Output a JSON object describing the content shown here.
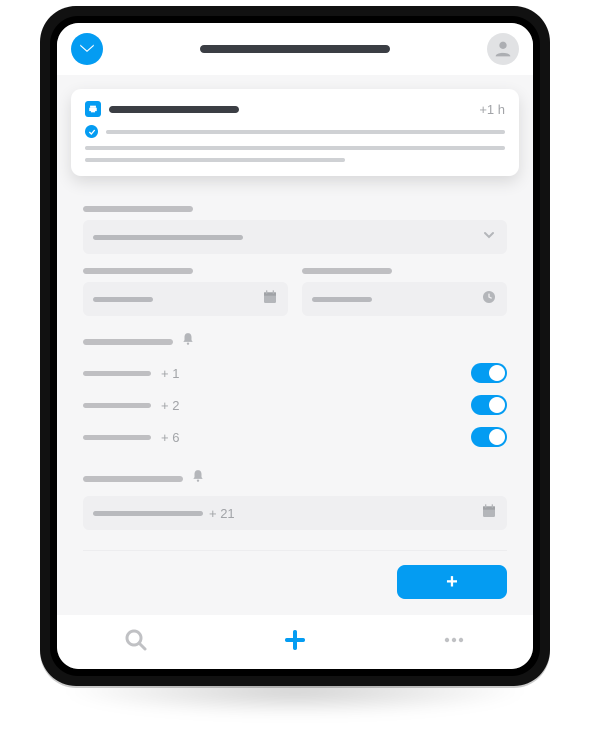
{
  "colors": {
    "brand": "#049CF2",
    "muted": "#bfbfc2",
    "field_bg": "#efeff1"
  },
  "topbar": {
    "logo_icon": "envelope-down-icon",
    "title_placeholder": true,
    "avatar_icon": "user-avatar-icon"
  },
  "card": {
    "icon": "printer-icon",
    "title_placeholder": true,
    "time_offset": "+1 h",
    "check_icon": "checkmark-icon",
    "body_lines": 3
  },
  "form": {
    "section1_label_placeholder": true,
    "dropdown": {
      "value_placeholder": true,
      "expand_icon": "chevron-down-icon"
    },
    "date_field": {
      "label_placeholder": true,
      "value_placeholder": true,
      "icon": "calendar-icon"
    },
    "time_field": {
      "label_placeholder": true,
      "value_placeholder": true,
      "icon": "clock-icon"
    },
    "reminders_header": {
      "label_placeholder": true,
      "icon": "bell-icon"
    },
    "reminder_options": [
      {
        "label_placeholder": true,
        "suffix": "+ 1",
        "enabled": true
      },
      {
        "label_placeholder": true,
        "suffix": "+ 2",
        "enabled": true
      },
      {
        "label_placeholder": true,
        "suffix": "+ 6",
        "enabled": true
      }
    ],
    "schedule_header": {
      "label_placeholder": true,
      "icon": "bell-icon"
    },
    "schedule_field": {
      "value_placeholder": true,
      "suffix": "+ 21",
      "icon": "calendar-icon"
    },
    "save_button": {
      "icon": "plus-icon",
      "label": "+"
    }
  },
  "bottomnav": {
    "items": [
      {
        "name": "search",
        "icon": "search-icon",
        "primary": false
      },
      {
        "name": "add",
        "icon": "plus-icon",
        "primary": true
      },
      {
        "name": "more",
        "icon": "more-icon",
        "primary": false
      }
    ]
  }
}
